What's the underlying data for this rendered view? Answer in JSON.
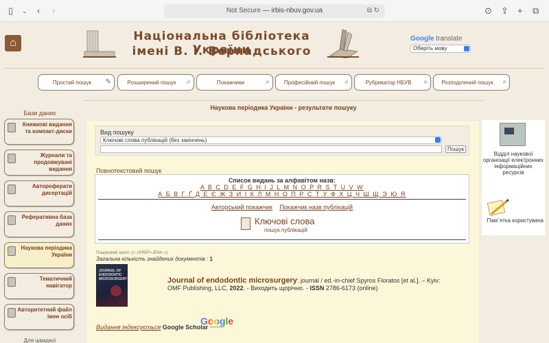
{
  "browser": {
    "url_security": "Not Secure",
    "url_separator": "—",
    "url_host": "irbis-nbuv.gov.ua"
  },
  "header": {
    "title_line1": "Національна бібліотека України",
    "title_line2": "імені В. І. Вернадського",
    "translate": {
      "brand": "Google",
      "word": "translate",
      "select_label": "Оберіть мову"
    }
  },
  "nav": [
    {
      "label": "Простий пошук"
    },
    {
      "label": "Розширений пошук"
    },
    {
      "label": "Покажчики"
    },
    {
      "label": "Професійний пошук"
    },
    {
      "label": "Рубрикатор НБУВ"
    },
    {
      "label": "Розподілений пошук"
    }
  ],
  "page_heading": "Наукова періодика України - результати пошуку",
  "sidebar": {
    "title": "Бази даних",
    "items": [
      {
        "label": "Книжкові видання та компакт-диски"
      },
      {
        "label": "Журнали та продовжувані видання"
      },
      {
        "label": "Автореферати дисертацій"
      },
      {
        "label": "Реферативна база даних"
      },
      {
        "label": "Наукова періодика України"
      },
      {
        "label": "Тематичний навігатор"
      },
      {
        "label": "Авторитетний файл імен осіб"
      }
    ],
    "more": "Для швидкої"
  },
  "search": {
    "type_label": "Вид пошуку",
    "type_value": "Ключові слова публікацій (без закінчень)",
    "button": "Пошук",
    "fulltext": "Повнотекстовий пошук"
  },
  "alphabet": {
    "title": "Список видань за алфавітом назв:",
    "latin": "A B C D E F G H I J L M N O P R S T U V W",
    "cyrillic": "А Б В Г Ґ Д Е Є Ж З И І К Л М Н О П Р С Т У Ф Х Ц Ч Ш Щ Э Ю Я",
    "link1": "Авторський покажчик",
    "link2": "Покажчик назв публікацій",
    "keywords_big": "Ключові слова",
    "keywords_small": "пошук публікацій"
  },
  "results": {
    "query": "Пошуковий запит: (<.>PREF=JEM<.>)",
    "total_label": "Загальна кількість знайдених документів :",
    "total_value": "1",
    "cover_text": "JOURNAL OF ENDODONTIC MICROSURGERY",
    "journal_title": "Journal of endodontic microsurgery",
    "record_rest": ": journal / ed.-in-chief Spyros Floratos [et al.]. – Kyiv: OMF Publishing, LLC, ",
    "year": "2022",
    "record_tail": ". - Виходить щорічно. - ",
    "issn_label": "ISSN",
    "issn_value": " 2786-6173 (online)"
  },
  "indexed": {
    "text": "Видання індексується",
    "scholar": "Google Scholar",
    "logo": "Google",
    "logo_sub": "Академія"
  },
  "right": {
    "org_text": "Відділ наукової організації електронних інформаційних ресурсів",
    "memo_text": "Пам`ятка користувача"
  },
  "colors": {
    "accent": "#7a3f1a",
    "background": "#f3ece1",
    "panel": "#fdf7da"
  }
}
